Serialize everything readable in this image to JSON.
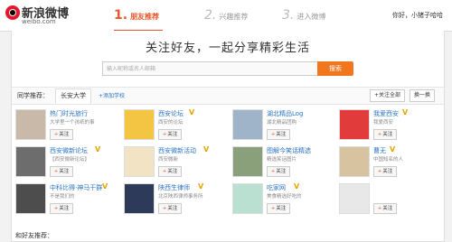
{
  "logo": {
    "main": "新浪微博",
    "sub": "weibo.com"
  },
  "steps": [
    {
      "num": "1.",
      "label": "朋友推荐"
    },
    {
      "num": "2.",
      "label": "兴趣推荐"
    },
    {
      "num": "3.",
      "label": "进入微博"
    }
  ],
  "user": {
    "name": "你好，小猪子哈哈"
  },
  "slogan": "关注好友，一起分享精彩生活",
  "search": {
    "placeholder": "输入昵称或名人邮箱",
    "button": "搜索"
  },
  "filter": {
    "label": "同学推荐：",
    "tab": "长安大学",
    "add": "+添加学校",
    "follow_all": "+关注全部",
    "next": "换一换"
  },
  "follow_label": "关注",
  "people": [
    {
      "name": "热门时光旅行",
      "desc": "大学里一个孩纸的事",
      "verified": false
    },
    {
      "name": "西安论坛",
      "desc": "西安的论坛",
      "verified": true
    },
    {
      "name": "湖北精品Log",
      "desc": "湖北精品团购",
      "verified": false
    },
    {
      "name": "我爱西安",
      "desc": "我爱西安",
      "verified": true
    },
    {
      "name": "西安微新论坛",
      "desc": "【西安微新论坛】",
      "verified": true
    },
    {
      "name": "西安微新活动",
      "desc": "西安微新",
      "verified": true
    },
    {
      "name": "图解今笑话精选",
      "desc": "精选笑话图片",
      "verified": false
    },
    {
      "name": "曹无",
      "desc": "中国知名的人",
      "verified": true
    },
    {
      "name": "中科比得·神马干群",
      "desc": "不是我们的",
      "verified": false
    },
    {
      "name": "陕西生律师",
      "desc": "北京陕西律师事务所",
      "verified": true
    },
    {
      "name": "吃家网",
      "desc": "美食精选好吃的",
      "verified": true
    },
    {
      "name": "",
      "desc": "",
      "verified": false
    }
  ],
  "bottom": "和好友推荐："
}
